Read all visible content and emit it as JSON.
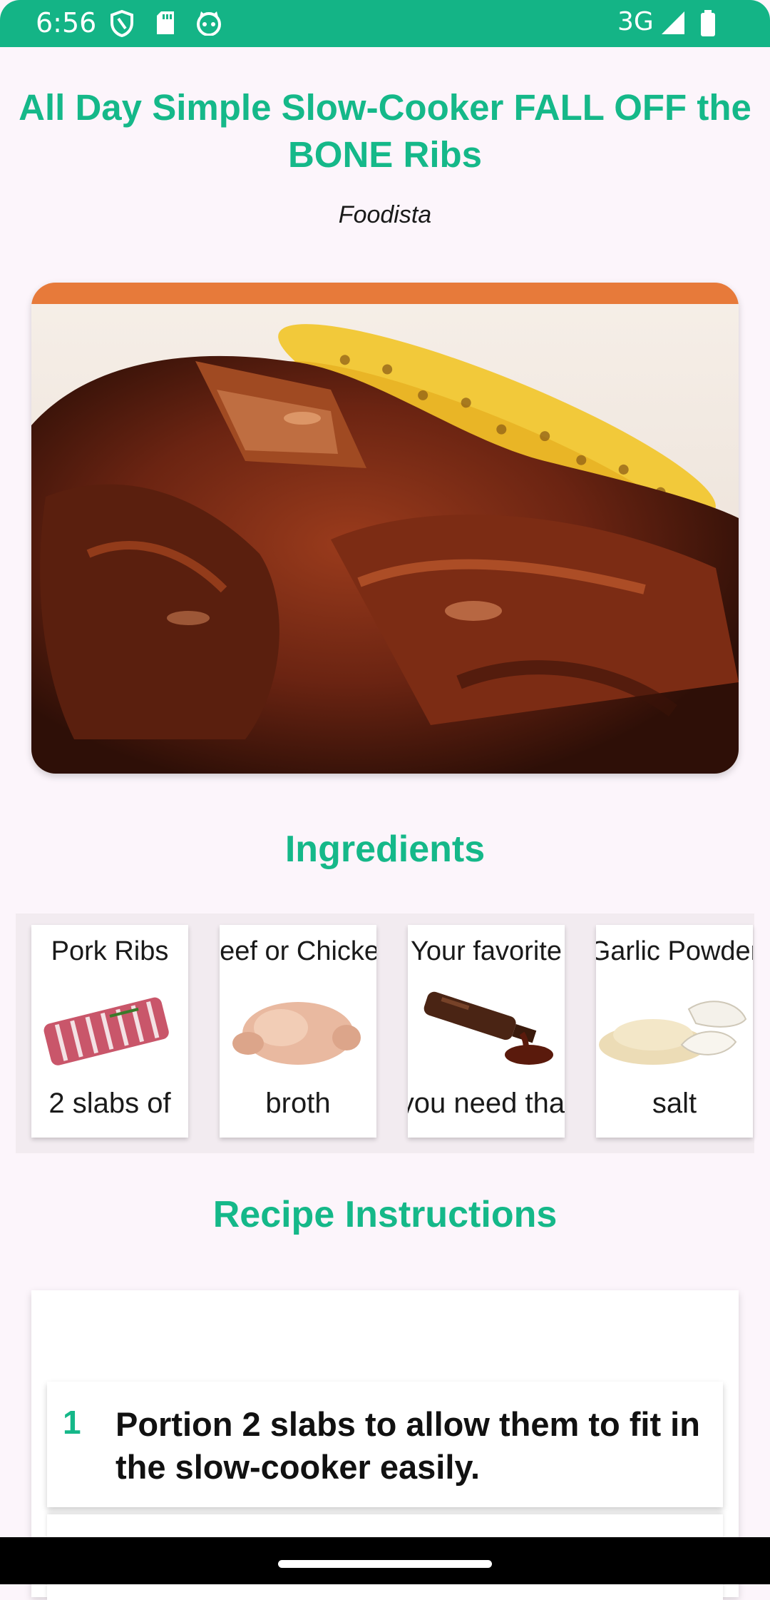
{
  "status_bar": {
    "time": "6:56",
    "network": "3G",
    "icons": [
      "shield-icon",
      "sd-card-icon",
      "cat-face-icon",
      "signal-icon",
      "battery-icon"
    ],
    "background_color": "#14b486"
  },
  "recipe": {
    "title": "All Day Simple Slow-Cooker FALL OFF the BONE Ribs",
    "source": "Foodista"
  },
  "ingredients": {
    "heading": "Ingredients",
    "items": [
      {
        "name": "Pork Ribs",
        "amount": "2 slabs of",
        "image": "pork-ribs"
      },
      {
        "name": "Beef or Chicken",
        "amount": "broth",
        "image": "chicken"
      },
      {
        "name": "Your favorite",
        "amount": "you need that",
        "image": "bbq-sauce"
      },
      {
        "name": "Garlic Powder",
        "amount": "salt",
        "image": "garlic-powder"
      }
    ]
  },
  "instructions": {
    "heading": "Recipe Instructions",
    "steps": [
      {
        "number": "1",
        "text": "Portion 2 slabs to allow them to fit in the slow-cooker easily."
      }
    ]
  },
  "accent_color": "#15b889"
}
